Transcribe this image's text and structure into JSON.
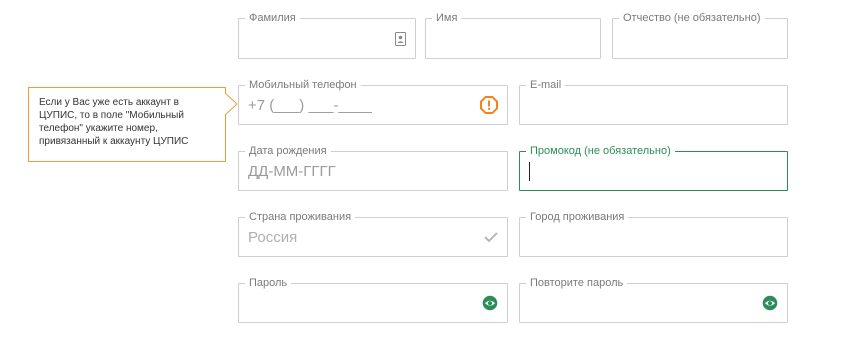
{
  "fields": {
    "surname": {
      "label": "Фамилия",
      "value": ""
    },
    "name": {
      "label": "Имя",
      "value": ""
    },
    "patronymic": {
      "label": "Отчество  (не обязательно)",
      "value": ""
    },
    "phone": {
      "label": "Мобильный телефон",
      "value": "+7 (___)  ___-____",
      "status": "warning"
    },
    "email": {
      "label": "E-mail",
      "value": ""
    },
    "birthdate": {
      "label": "Дата рождения",
      "value": "ДД-ММ-ГГГГ"
    },
    "promocode": {
      "label": "Промокод  (не обязательно)",
      "value": "",
      "focused": true
    },
    "country": {
      "label": "Страна проживания",
      "value": "Россия",
      "status": "valid"
    },
    "city": {
      "label": "Город проживания",
      "value": ""
    },
    "password": {
      "label": "Пароль",
      "value": ""
    },
    "password_repeat": {
      "label": "Повторите пароль",
      "value": ""
    }
  },
  "tooltip": {
    "text": "Если у Вас уже есть аккаунт в ЦУПИС, то в поле \"Мобильный телефон\" укажите номер, привязанный к аккаунту ЦУПИС"
  },
  "icons": {
    "surname": "contact-card-icon",
    "phone": "warning-icon",
    "country": "checkmark-icon",
    "password": "eye-icon",
    "password_repeat": "eye-icon"
  },
  "colors": {
    "border": "#cfcfcf",
    "label": "#7a7a7a",
    "placeholder": "#9b9b9b",
    "accent_green": "#2e8c5a",
    "warning_orange": "#f0851f",
    "tooltip_border": "#f29a38",
    "check_gray": "#b8b8b8"
  }
}
